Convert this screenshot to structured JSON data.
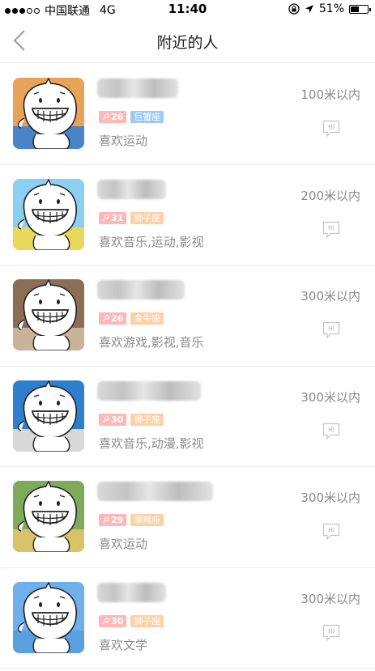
{
  "status_bar": {
    "carrier": "中国联通",
    "network": "4G",
    "time": "11:40",
    "battery_percent": "51%",
    "battery_level": 0.51
  },
  "nav": {
    "title": "附近的人"
  },
  "people": [
    {
      "age": "26",
      "star_sign": "巨蟹座",
      "star_color": "#9cc9f5",
      "interests": "喜欢运动",
      "distance": "100米以内",
      "hi": "HI"
    },
    {
      "age": "31",
      "star_sign": "狮子座",
      "star_color": "#ffcfa6",
      "interests": "喜欢音乐,运动,影视",
      "distance": "200米以内",
      "hi": "HI"
    },
    {
      "age": "26",
      "star_sign": "金牛座",
      "star_color": "#ffcfa6",
      "interests": "喜欢游戏,影视,音乐",
      "distance": "300米以内",
      "hi": "HI"
    },
    {
      "age": "30",
      "star_sign": "狮子座",
      "star_color": "#ffcfa6",
      "interests": "喜欢音乐,动漫,影视",
      "distance": "300米以内",
      "hi": "HI"
    },
    {
      "age": "29",
      "star_sign": "摩羯座",
      "star_color": "#ffcfa6",
      "interests": "喜欢运动",
      "distance": "300米以内",
      "hi": "HI"
    },
    {
      "age": "30",
      "star_sign": "狮子座",
      "star_color": "#ffcfa6",
      "interests": "喜欢文学",
      "distance": "300米以内",
      "hi": "HI"
    }
  ],
  "colors": {
    "age_tag": "#ffb7b7",
    "secondary_text": "#8a8a8a",
    "divider": "#ececec"
  }
}
